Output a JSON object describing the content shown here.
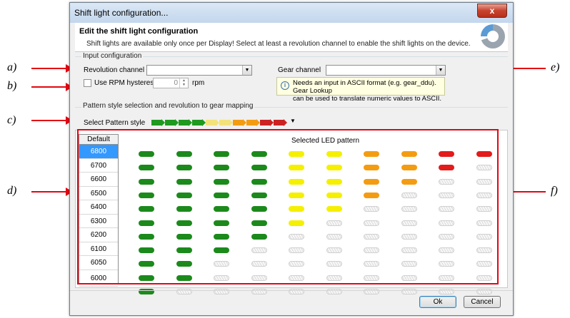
{
  "window": {
    "title": "Shift light configuration...",
    "close_label": "x"
  },
  "header": {
    "title": "Edit the shift light configuration",
    "subtitle": "Shift lights are available only once per Display! Select at least a revolution channel to enable the shift lights on the device."
  },
  "input_config": {
    "group_title": "Input configuration",
    "revolution_label": "Revolution channel",
    "revolution_value": "",
    "gear_label": "Gear channel",
    "gear_value": "",
    "use_rpm_hysteresis_label": "Use RPM hysteresis",
    "use_rpm_hysteresis_checked": false,
    "hysteresis_value": "0",
    "hysteresis_unit": "rpm",
    "info_text_1": "Needs an input in ASCII format (e.g. gear_ddu). Gear Lookup",
    "info_text_2": "can be used to translate numeric values to ASCII."
  },
  "pattern": {
    "group_title": "Pattern style selection and revolution to gear mapping",
    "select_label": "Select Pattern style",
    "style_colors": [
      "#1e9a1e",
      "#1e9a1e",
      "#1e9a1e",
      "#1e9a1e",
      "#f2e27a",
      "#f2e27a",
      "#f39c12",
      "#f39c12",
      "#cc2222",
      "#cc2222"
    ]
  },
  "grid": {
    "list_header": "Default",
    "rpm_values": [
      "6800",
      "6700",
      "6600",
      "6500",
      "6400",
      "6300",
      "6200",
      "6100",
      "6050",
      "6000"
    ],
    "selected_rpm": "6800",
    "title": "Selected LED pattern",
    "led_colors": [
      "#1b8a1b",
      "#1b8a1b",
      "#1b8a1b",
      "#1b8a1b",
      "#f5ef00",
      "#f5ef00",
      "#f39c12",
      "#f39c12",
      "#e31b1b",
      "#e31b1b"
    ],
    "row_lit_counts": [
      10,
      9,
      8,
      7,
      6,
      5,
      4,
      3,
      2,
      2,
      1
    ]
  },
  "buttons": {
    "ok": "Ok",
    "cancel": "Cancel"
  },
  "annotations": {
    "a": "a)",
    "b": "b)",
    "c": "c)",
    "d": "d)",
    "e": "e)",
    "f": "f)"
  },
  "annotation_color": "#e30613"
}
